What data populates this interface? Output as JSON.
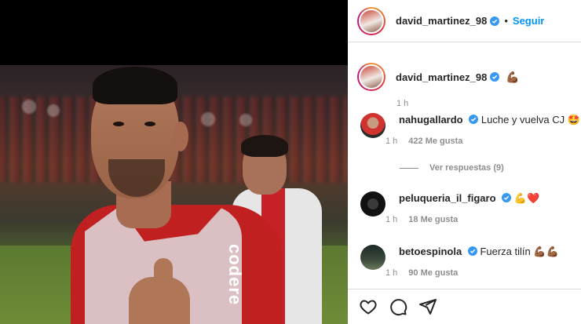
{
  "post": {
    "author": "david_martinez_98",
    "follow_label": "Seguir",
    "separator": "•",
    "caption_emoji": "💪🏾",
    "caption_time": "1 h",
    "sponsor_text": "codere"
  },
  "comments": [
    {
      "user": "nahugallardo",
      "text": "Luche y vuelva CJ",
      "emoji": "🤩",
      "time": "1 h",
      "likes": "422 Me gusta",
      "view_replies": "Ver respuestas (9)"
    },
    {
      "user": "peluqueria_il_figaro",
      "text": "",
      "emoji": "💪❤️",
      "time": "1 h",
      "likes": "18 Me gusta"
    },
    {
      "user": "betoespinola",
      "text": "Fuerza tilín",
      "emoji": "💪🏾💪🏾",
      "time": "1 h",
      "likes": "90 Me gusta"
    }
  ],
  "colors": {
    "link": "#0095f6",
    "verified": "#3897f0",
    "secondary_text": "#8e8e8e"
  },
  "icons": [
    "heart-icon",
    "comment-icon",
    "share-icon",
    "verified-icon"
  ]
}
